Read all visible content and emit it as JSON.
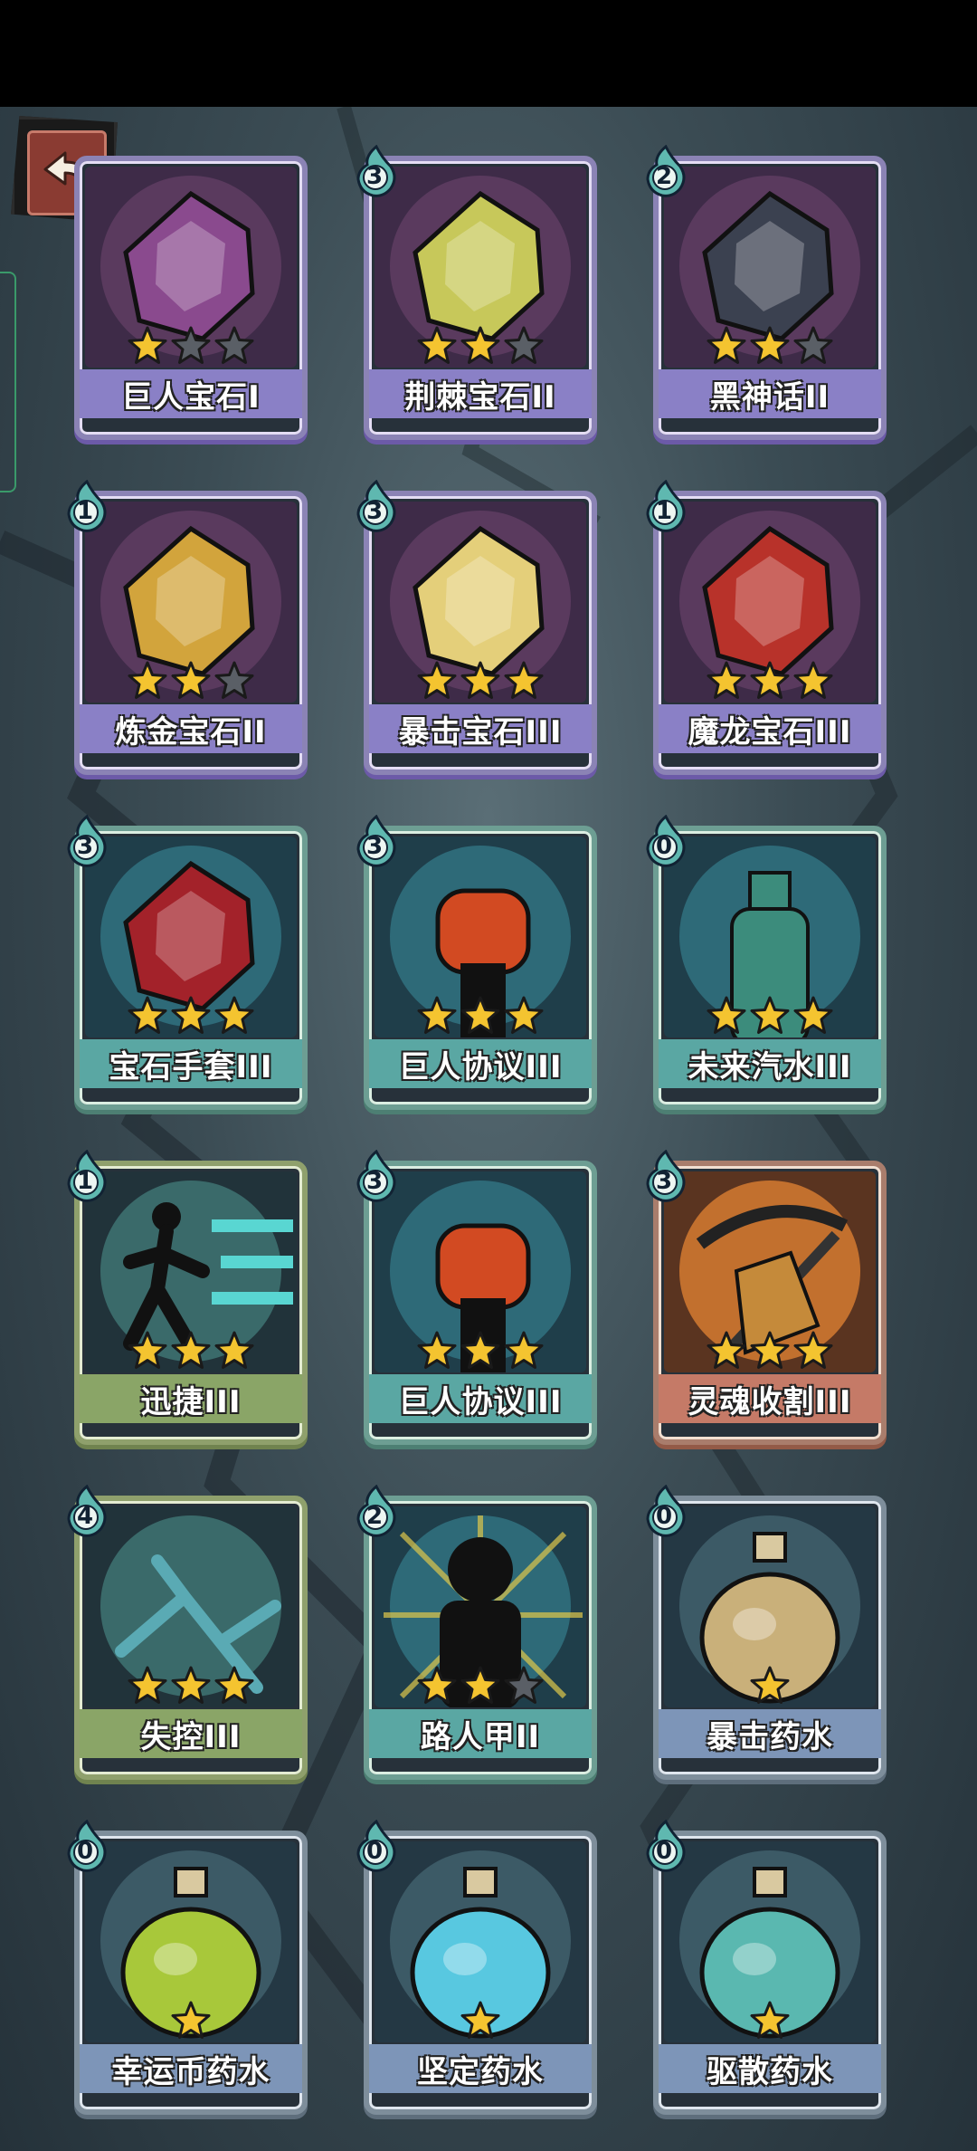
{
  "back_button": {
    "icon": "back-arrow-icon"
  },
  "cards": [
    {
      "name": "巨人宝石I",
      "cost": "",
      "stars": 1,
      "max_stars": 3,
      "theme": "purple",
      "art": "purple-gem-icon",
      "art_color": "#8a4a8e"
    },
    {
      "name": "荆棘宝石II",
      "cost": "3",
      "stars": 2,
      "max_stars": 3,
      "theme": "purple",
      "art": "thorn-gem-icon",
      "art_color": "#c7c85a"
    },
    {
      "name": "黑神话II",
      "cost": "2",
      "stars": 2,
      "max_stars": 3,
      "theme": "purple",
      "art": "black-myth-gem-icon",
      "art_color": "#3b4150"
    },
    {
      "name": "炼金宝石II",
      "cost": "1",
      "stars": 2,
      "max_stars": 3,
      "theme": "purple",
      "art": "alchemy-gem-icon",
      "art_color": "#d2a43c"
    },
    {
      "name": "暴击宝石III",
      "cost": "3",
      "stars": 3,
      "max_stars": 3,
      "theme": "purple",
      "art": "crit-gem-icon",
      "art_color": "#e4cf7a"
    },
    {
      "name": "魔龙宝石III",
      "cost": "1",
      "stars": 3,
      "max_stars": 3,
      "theme": "purple",
      "art": "dragon-gem-icon",
      "art_color": "#b8322a"
    },
    {
      "name": "宝石手套III",
      "cost": "3",
      "stars": 3,
      "max_stars": 3,
      "theme": "teal",
      "art": "gem-gauntlet-icon",
      "art_color": "#a3222a"
    },
    {
      "name": "巨人协议III",
      "cost": "3",
      "stars": 3,
      "max_stars": 3,
      "theme": "teal",
      "art": "raised-fist-icon",
      "art_color": "#d24a22"
    },
    {
      "name": "未来汽水III",
      "cost": "0",
      "stars": 3,
      "max_stars": 3,
      "theme": "teal",
      "art": "soda-bottle-icon",
      "art_color": "#3c8c7c"
    },
    {
      "name": "迅捷III",
      "cost": "1",
      "stars": 3,
      "max_stars": 3,
      "theme": "olive",
      "art": "running-man-icon",
      "art_color": "#59d6d2"
    },
    {
      "name": "巨人协议III",
      "cost": "3",
      "stars": 3,
      "max_stars": 3,
      "theme": "teal",
      "art": "raised-fist-icon",
      "art_color": "#d24a22"
    },
    {
      "name": "灵魂收割III",
      "cost": "3",
      "stars": 3,
      "max_stars": 3,
      "theme": "red",
      "art": "scythe-icon",
      "art_color": "#c58a3a"
    },
    {
      "name": "失控III",
      "cost": "4",
      "stars": 3,
      "max_stars": 3,
      "theme": "olive",
      "art": "broken-claw-icon",
      "art_color": "#5aaab4"
    },
    {
      "name": "路人甲II",
      "cost": "2",
      "stars": 2,
      "max_stars": 3,
      "theme": "teal",
      "art": "shadow-figure-icon",
      "art_color": "#e0c84a"
    },
    {
      "name": "暴击药水",
      "cost": "0",
      "stars": 1,
      "max_stars": 1,
      "theme": "slate",
      "art": "crit-potion-icon",
      "art_color": "#c9b07a"
    },
    {
      "name": "幸运币药水",
      "cost": "0",
      "stars": 1,
      "max_stars": 1,
      "theme": "slate",
      "art": "lucky-coin-potion-icon",
      "art_color": "#a8c83a"
    },
    {
      "name": "坚定药水",
      "cost": "0",
      "stars": 1,
      "max_stars": 1,
      "theme": "slate",
      "art": "firm-potion-icon",
      "art_color": "#58c8e0"
    },
    {
      "name": "驱散药水",
      "cost": "0",
      "stars": 1,
      "max_stars": 1,
      "theme": "slate",
      "art": "dispel-potion-icon",
      "art_color": "#5ab8b0"
    }
  ],
  "colors": {
    "star_on": "#f4c430",
    "star_off": "#5a5f66",
    "cost_drop": "#5fb8b0"
  }
}
